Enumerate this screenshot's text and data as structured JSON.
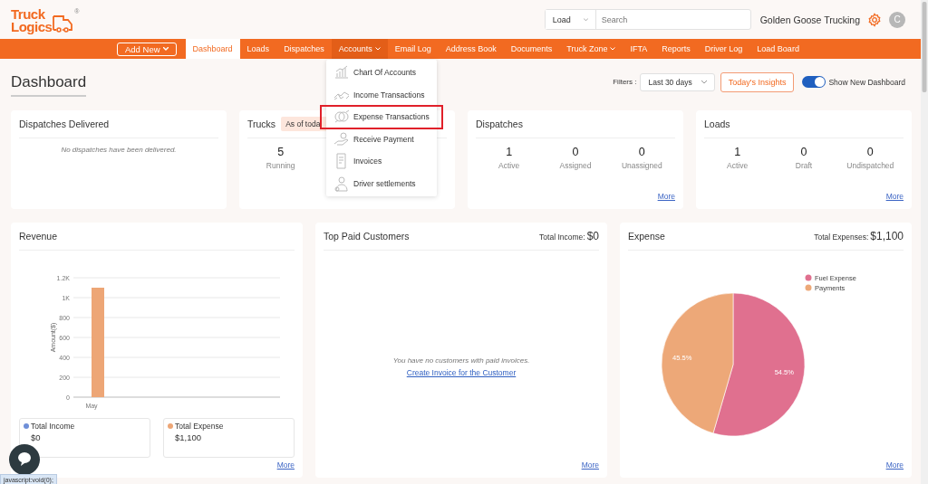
{
  "header": {
    "logo": {
      "lines": [
        "Truck",
        "Logics"
      ],
      "mark": "®"
    },
    "search": {
      "scope": "Load",
      "placeholder": "Search"
    },
    "company": "Golden Goose Trucking",
    "avatar": "C"
  },
  "nav": {
    "add_new": "Add New",
    "items": [
      {
        "label": "Dashboard",
        "selected": true,
        "has_menu": false,
        "expanded": false
      },
      {
        "label": "Loads",
        "selected": false,
        "has_menu": false,
        "expanded": false
      },
      {
        "label": "Dispatches",
        "selected": false,
        "has_menu": false,
        "expanded": false
      },
      {
        "label": "Accounts",
        "selected": false,
        "has_menu": true,
        "expanded": true
      },
      {
        "label": "Email Log",
        "selected": false,
        "has_menu": false,
        "expanded": false
      },
      {
        "label": "Address Book",
        "selected": false,
        "has_menu": false,
        "expanded": false
      },
      {
        "label": "Documents",
        "selected": false,
        "has_menu": false,
        "expanded": false
      },
      {
        "label": "Truck Zone",
        "selected": false,
        "has_menu": true,
        "expanded": false
      },
      {
        "label": "IFTA",
        "selected": false,
        "has_menu": false,
        "expanded": false
      },
      {
        "label": "Reports",
        "selected": false,
        "has_menu": false,
        "expanded": false
      },
      {
        "label": "Driver Log",
        "selected": false,
        "has_menu": false,
        "expanded": false
      },
      {
        "label": "Load Board",
        "selected": false,
        "has_menu": false,
        "expanded": false
      }
    ]
  },
  "accounts_menu": {
    "items": [
      {
        "label": "Chart Of Accounts",
        "highlighted": false
      },
      {
        "label": "Income Transactions",
        "highlighted": false
      },
      {
        "label": "Expense Transactions",
        "highlighted": true
      },
      {
        "label": "Receive Payment",
        "highlighted": false
      },
      {
        "label": "Invoices",
        "highlighted": false
      },
      {
        "label": "Driver settlements",
        "highlighted": false
      }
    ]
  },
  "page": {
    "title": "Dashboard",
    "filters_label": "Filters :",
    "period": "Last 30 days",
    "insights_button": "Today's Insights",
    "toggle": {
      "label": "Show New Dashboard",
      "on": true
    }
  },
  "summary_cards": [
    {
      "title": "Dispatches Delivered",
      "empty_message": "No dispatches have been delivered."
    },
    {
      "title": "Trucks",
      "badge": "As of toda",
      "stats": [
        {
          "value": "5",
          "label": "Running"
        }
      ]
    },
    {
      "title": "Dispatches",
      "stats": [
        {
          "value": "1",
          "label": "Active"
        },
        {
          "value": "0",
          "label": "Assigned"
        },
        {
          "value": "0",
          "label": "Unassigned"
        }
      ],
      "more": "More"
    },
    {
      "title": "Loads",
      "stats": [
        {
          "value": "1",
          "label": "Active"
        },
        {
          "value": "0",
          "label": "Draft"
        },
        {
          "value": "0",
          "label": "Undispatched"
        }
      ],
      "more": "More"
    }
  ],
  "revenue": {
    "title": "Revenue",
    "chart_data": {
      "type": "bar",
      "ylabel": "Amount($)",
      "categories": [
        "May"
      ],
      "series": [
        {
          "name": "Total Income",
          "color": "#6f8fd8",
          "values": [
            0
          ]
        },
        {
          "name": "Total Expense",
          "color": "#eda676",
          "values": [
            1100
          ]
        }
      ],
      "grid": true,
      "ylim": [
        0,
        1200
      ],
      "yticks": [
        0,
        200,
        400,
        600,
        800,
        {
          "value": 1000,
          "label": "1K"
        },
        {
          "value": 1200,
          "label": "1.2K"
        }
      ]
    },
    "totals": [
      {
        "value": "$0"
      },
      {
        "value": "$1,100"
      }
    ],
    "more": "More"
  },
  "top_customers": {
    "title": "Top Paid Customers",
    "total_label": "Total Income:",
    "total_value": "$0",
    "empty_message": "You have no customers with paid invoices.",
    "link": "Create Invoice for the Customer",
    "more": "More"
  },
  "expense": {
    "title": "Expense",
    "total_label": "Total Expenses:",
    "total_value": "$1,100",
    "chart_data": {
      "type": "pie",
      "categories": [
        "Fuel Expense",
        "Payments"
      ],
      "values": [
        54.5,
        45.5
      ],
      "colors": [
        "#e0708f",
        "#eda878"
      ],
      "value_labels": [
        "54.5%",
        "45.5%"
      ],
      "legend": true
    },
    "more": "More"
  },
  "status_tooltip": "javascript:void(0);"
}
